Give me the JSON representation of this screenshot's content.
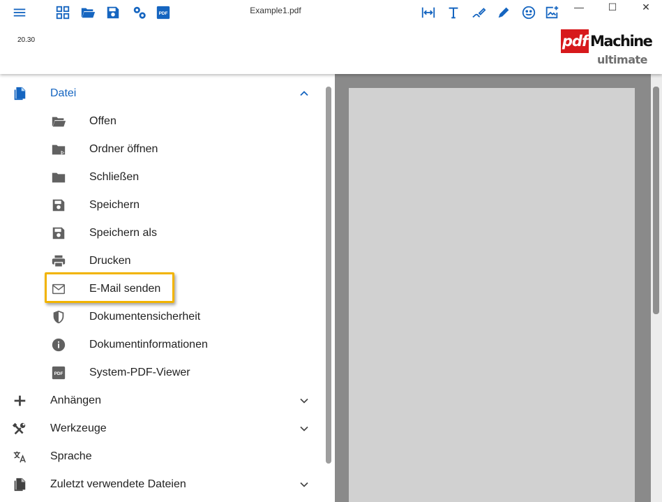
{
  "header": {
    "document_title": "Example1.pdf",
    "version": "20.30",
    "toolbar_left": [
      "menu-icon",
      "grid-icon",
      "folder-open-icon",
      "save-icon",
      "settings-icon",
      "pdf-icon"
    ],
    "toolbar_right": [
      "fit-width-icon",
      "text-icon",
      "draw-icon",
      "pen-icon",
      "emoji-icon",
      "add-image-icon"
    ],
    "window_controls": {
      "minimize": "—",
      "maximize": "☐",
      "close": "✕"
    },
    "logo": {
      "pdf": "pdf",
      "machine": "Machine",
      "edition": "ultimate"
    }
  },
  "sidebar": {
    "file_section": {
      "label": "Datei",
      "icon": "document-icon",
      "expanded": true,
      "items": [
        {
          "label": "Offen",
          "icon": "folder-open-icon"
        },
        {
          "label": "Ordner öffnen",
          "icon": "folder-play-icon"
        },
        {
          "label": "Schließen",
          "icon": "folder-icon"
        },
        {
          "label": "Speichern",
          "icon": "save-icon"
        },
        {
          "label": "Speichern als",
          "icon": "save-as-icon"
        },
        {
          "label": "Drucken",
          "icon": "printer-icon"
        },
        {
          "label": "E-Mail senden",
          "icon": "email-icon",
          "highlighted": true
        },
        {
          "label": "Dokumentensicherheit",
          "icon": "shield-icon"
        },
        {
          "label": "Dokumentinformationen",
          "icon": "info-icon"
        },
        {
          "label": "System-PDF-Viewer",
          "icon": "pdf-viewer-icon"
        }
      ]
    },
    "other_sections": [
      {
        "label": "Anhängen",
        "icon": "plus-icon",
        "has_chevron": true
      },
      {
        "label": "Werkzeuge",
        "icon": "tools-icon",
        "has_chevron": true
      },
      {
        "label": "Sprache",
        "icon": "translate-icon",
        "has_chevron": false
      },
      {
        "label": "Zuletzt verwendete Dateien",
        "icon": "recent-files-icon",
        "has_chevron": true
      }
    ]
  },
  "colors": {
    "accent": "#1565c0",
    "icon_gray": "#616161",
    "highlight": "#f2b400",
    "viewer_bg": "#8a8a8a",
    "page_bg": "#d1d1d1"
  }
}
